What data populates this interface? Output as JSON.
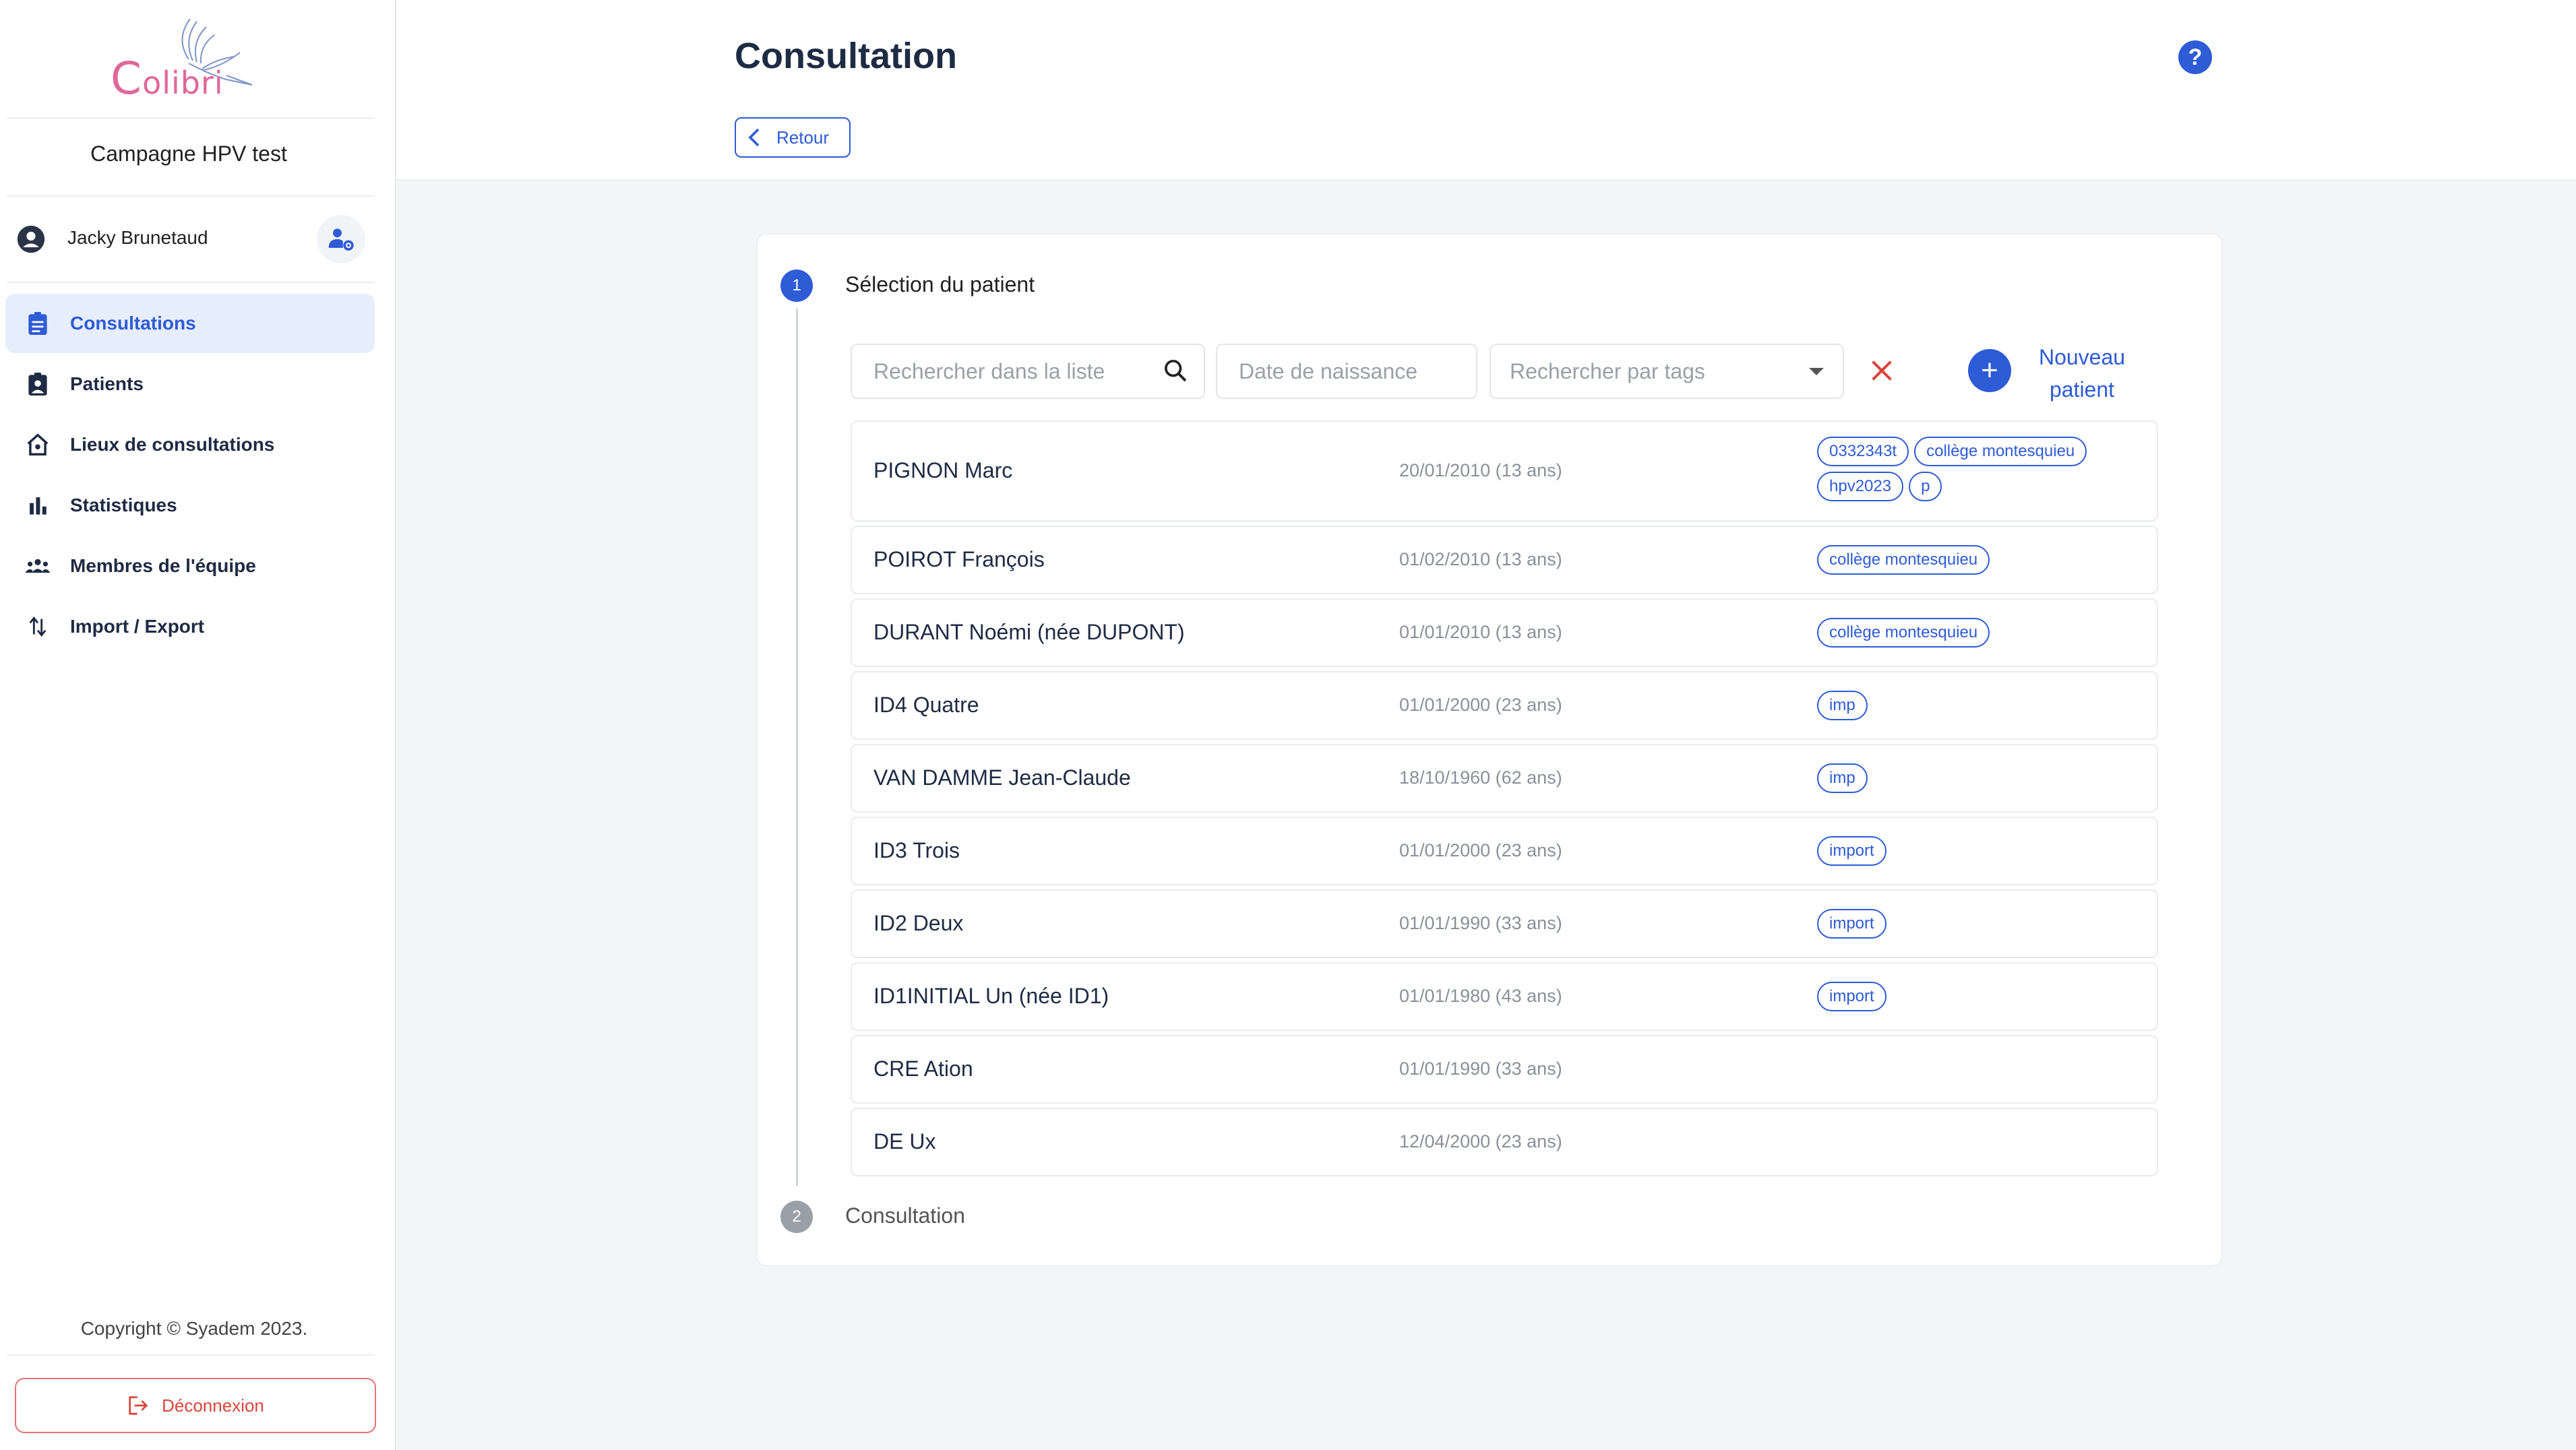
{
  "sidebar": {
    "logo_c": "C",
    "logo_rest": "olibri",
    "campaign": "Campagne HPV test",
    "user_name": "Jacky Brunetaud",
    "nav": [
      {
        "label": "Consultations",
        "icon": "clipboard-icon",
        "active": true
      },
      {
        "label": "Patients",
        "icon": "patient-badge-icon",
        "active": false
      },
      {
        "label": "Lieux de consultations",
        "icon": "home-location-icon",
        "active": false
      },
      {
        "label": "Statistiques",
        "icon": "bar-chart-icon",
        "active": false
      },
      {
        "label": "Membres de l'équipe",
        "icon": "team-icon",
        "active": false
      },
      {
        "label": "Import / Export",
        "icon": "import-export-icon",
        "active": false
      }
    ],
    "copyright": "Copyright © Syadem 2023.",
    "logout": "Déconnexion"
  },
  "header": {
    "title": "Consultation",
    "back": "Retour",
    "help": "?"
  },
  "stepper": {
    "step1_number": "1",
    "step1_label": "Sélection du patient",
    "step2_number": "2",
    "step2_label": "Consultation"
  },
  "filters": {
    "search_placeholder": "Rechercher dans la liste",
    "date_placeholder": "Date de naissance",
    "tags_placeholder": "Rechercher par tags",
    "new_patient": "Nouveau patient"
  },
  "patients": [
    {
      "name": "PIGNON Marc",
      "dob": "20/01/2010 (13 ans)",
      "tags": [
        "0332343t",
        "collège montesquieu",
        "hpv2023",
        "p"
      ]
    },
    {
      "name": "POIROT François",
      "dob": "01/02/2010 (13 ans)",
      "tags": [
        "collège montesquieu"
      ]
    },
    {
      "name": "DURANT Noémi (née DUPONT)",
      "dob": "01/01/2010 (13 ans)",
      "tags": [
        "collège montesquieu"
      ]
    },
    {
      "name": "ID4 Quatre",
      "dob": "01/01/2000 (23 ans)",
      "tags": [
        "imp"
      ]
    },
    {
      "name": "VAN DAMME Jean-Claude",
      "dob": "18/10/1960 (62 ans)",
      "tags": [
        "imp"
      ]
    },
    {
      "name": "ID3 Trois",
      "dob": "01/01/2000 (23 ans)",
      "tags": [
        "import"
      ]
    },
    {
      "name": "ID2 Deux",
      "dob": "01/01/1990 (33 ans)",
      "tags": [
        "import"
      ]
    },
    {
      "name": "ID1INITIAL Un (née ID1)",
      "dob": "01/01/1980 (43 ans)",
      "tags": [
        "import"
      ]
    },
    {
      "name": "CRE Ation",
      "dob": "01/01/1990 (33 ans)",
      "tags": []
    },
    {
      "name": "DE Ux",
      "dob": "12/04/2000 (23 ans)",
      "tags": []
    }
  ],
  "colors": {
    "accent": "#2e5bd6",
    "logo": "#e0679a",
    "danger": "#d9453c"
  }
}
